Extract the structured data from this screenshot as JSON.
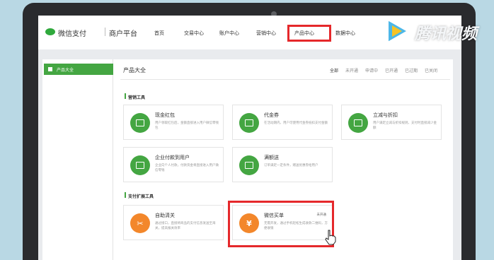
{
  "brand": {
    "logo_text": "微信支付",
    "platform": "商户平台"
  },
  "nav": {
    "items": [
      {
        "label": "首页"
      },
      {
        "label": "交易中心"
      },
      {
        "label": "账户中心"
      },
      {
        "label": "营销中心"
      },
      {
        "label": "产品中心"
      },
      {
        "label": "数据中心"
      }
    ],
    "active": "产品中心"
  },
  "sidebar": {
    "items": [
      {
        "label": "产品大全",
        "active": true
      }
    ]
  },
  "main": {
    "title": "产品大全",
    "filters": [
      {
        "label": "全部"
      },
      {
        "label": "未开通"
      },
      {
        "label": "申请中"
      },
      {
        "label": "已开通"
      },
      {
        "label": "已过期"
      },
      {
        "label": "已关闭"
      }
    ],
    "active_filter": "全部"
  },
  "sections": [
    {
      "title": "营销工具",
      "cards": [
        {
          "title": "现金红包",
          "desc": "用户领取红包后，金额直接进入用户微信零钱包",
          "icon": "wallet-icon",
          "color": "#44a642"
        },
        {
          "title": "代金券",
          "desc": "在活动期内，用户可使用代金券抵扣支付金额",
          "icon": "coupon-icon",
          "color": "#44a642"
        },
        {
          "title": "立减与折扣",
          "desc": "用户满足立减与折扣规则，支付时直接减少金额",
          "icon": "discount-icon",
          "color": "#44a642"
        },
        {
          "title": "企业付款到用户",
          "desc": "企业向个人付款，付款资金将直接进入用户微信零钱",
          "icon": "enterprise-pay-icon",
          "color": "#44a642"
        },
        {
          "title": "满额送",
          "desc": "订单满足一定条件，赠送优惠券给用户",
          "icon": "gift-icon",
          "color": "#44a642"
        }
      ]
    },
    {
      "title": "支付扩展工具",
      "cards": [
        {
          "title": "自助清关",
          "desc": "通过接口，直接将商品的支付信息发送至海关，提高报关效率",
          "icon": "customs-icon",
          "color": "#f3872b"
        },
        {
          "title": "微信买单",
          "desc": "无需开发，通过手机轻松生成收款二维码，方便收银",
          "icon": "yuan-icon",
          "color": "#f3872b",
          "badge": "未开通"
        }
      ]
    }
  ],
  "watermark": {
    "text": "腾讯视频"
  }
}
